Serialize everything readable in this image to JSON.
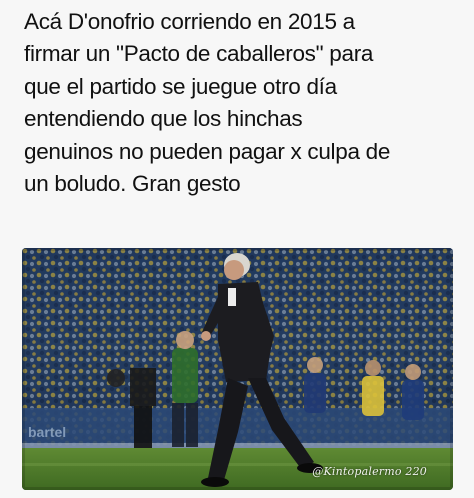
{
  "post": {
    "caption_lines": [
      "Acá D'onofrio corriendo en 2015 a",
      "firmar un \"Pacto de caballeros\" para",
      "que el partido se juegue otro día",
      "entendiendo que los hinchas",
      "genuinos no pueden pagar x culpa de",
      "un boludo. Gran gesto"
    ]
  },
  "photo": {
    "board_text": "bartel",
    "watermark": "@Kintopalermo 220",
    "colors": {
      "stands_blue": "#1f3a6a",
      "stands_yellow": "#e8c93a",
      "pitch": "#4f7a2a",
      "suit": "#1c1c20"
    }
  }
}
